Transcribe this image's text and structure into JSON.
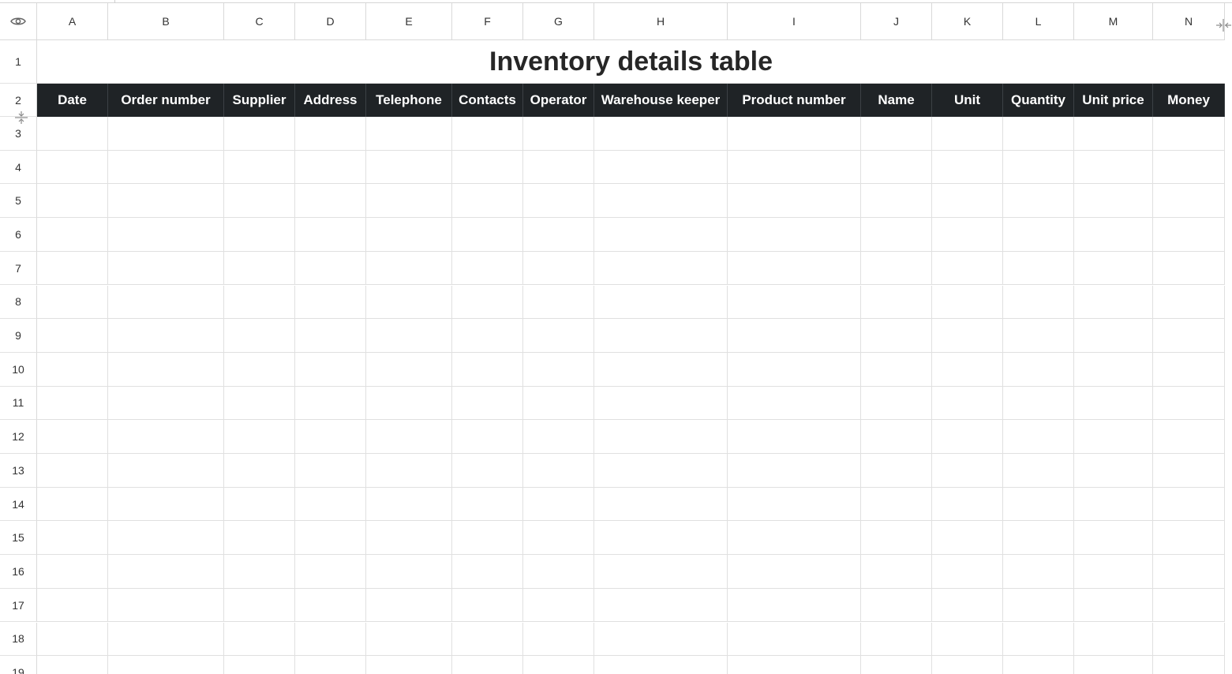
{
  "sheet": {
    "title": "Inventory details table",
    "columns": [
      {
        "letter": "A",
        "header": "Date"
      },
      {
        "letter": "B",
        "header": "Order number"
      },
      {
        "letter": "C",
        "header": "Supplier"
      },
      {
        "letter": "D",
        "header": "Address"
      },
      {
        "letter": "E",
        "header": "Telephone"
      },
      {
        "letter": "F",
        "header": "Contacts"
      },
      {
        "letter": "G",
        "header": "Operator"
      },
      {
        "letter": "H",
        "header": "Warehouse keeper"
      },
      {
        "letter": "I",
        "header": "Product number"
      },
      {
        "letter": "J",
        "header": "Name"
      },
      {
        "letter": "K",
        "header": "Unit"
      },
      {
        "letter": "L",
        "header": "Quantity"
      },
      {
        "letter": "M",
        "header": "Unit price"
      },
      {
        "letter": "N",
        "header": "Money"
      }
    ],
    "row_numbers": [
      "1",
      "2",
      "3",
      "4",
      "5",
      "6",
      "7",
      "8",
      "9",
      "10",
      "11",
      "12",
      "13",
      "14",
      "15",
      "16",
      "17",
      "18",
      "19"
    ]
  },
  "icons": {
    "corner": "eye-icon",
    "row_resize": "row-resize-icon",
    "col_resize": "column-resize-icon"
  },
  "colors": {
    "header_bg": "#1f2326",
    "header_text": "#ffffff",
    "grid": "#e0e0e0"
  }
}
